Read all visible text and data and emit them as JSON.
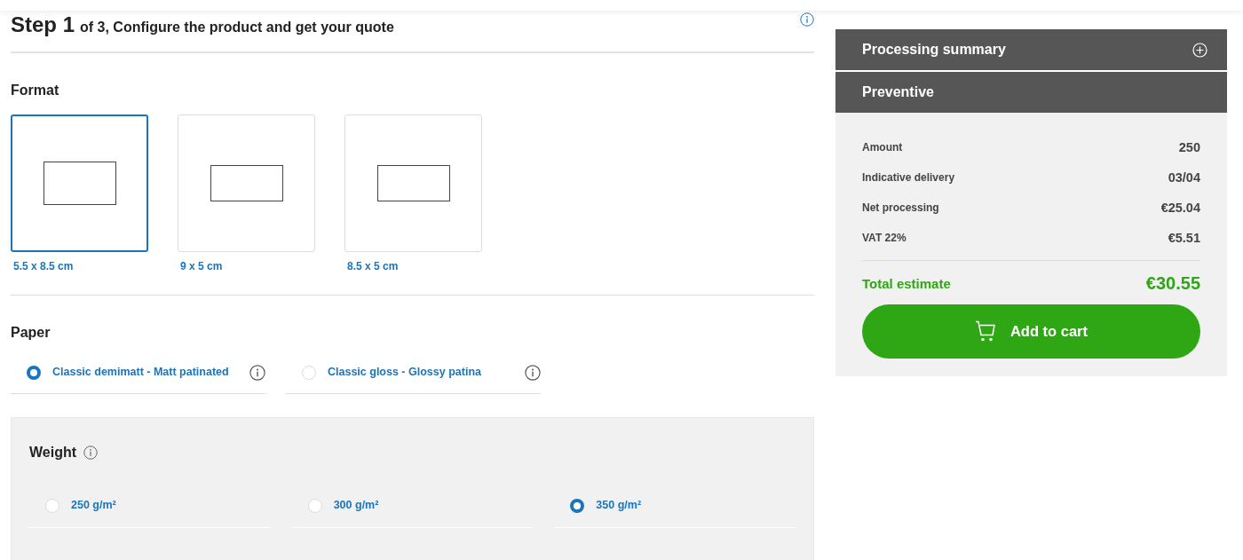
{
  "step": {
    "number": "Step 1",
    "text": "of 3, Configure the product and get your quote"
  },
  "format": {
    "title": "Format",
    "options": [
      {
        "label": "5.5 x 8.5 cm",
        "selected": true
      },
      {
        "label": "9 x 5 cm",
        "selected": false
      },
      {
        "label": "8.5 x 5 cm",
        "selected": false
      }
    ]
  },
  "paper": {
    "title": "Paper",
    "options": [
      {
        "label": "Classic demimatt - Matt patinated",
        "selected": true
      },
      {
        "label": "Classic gloss - Glossy patina",
        "selected": false
      }
    ]
  },
  "weight": {
    "title": "Weight",
    "options": [
      {
        "label": "250 g/m²",
        "selected": false
      },
      {
        "label": "300 g/m²",
        "selected": false
      },
      {
        "label": "350 g/m²",
        "selected": true
      }
    ]
  },
  "summary": {
    "title": "Processing summary",
    "section": "Preventive",
    "rows": [
      {
        "label": "Amount",
        "value": "250"
      },
      {
        "label": "Indicative delivery",
        "value": "03/04"
      },
      {
        "label": "Net processing",
        "value": "€25.04"
      },
      {
        "label": "VAT 22%",
        "value": "€5.51"
      }
    ],
    "total": {
      "label": "Total estimate",
      "value": "€30.55"
    },
    "button": "Add to cart"
  }
}
